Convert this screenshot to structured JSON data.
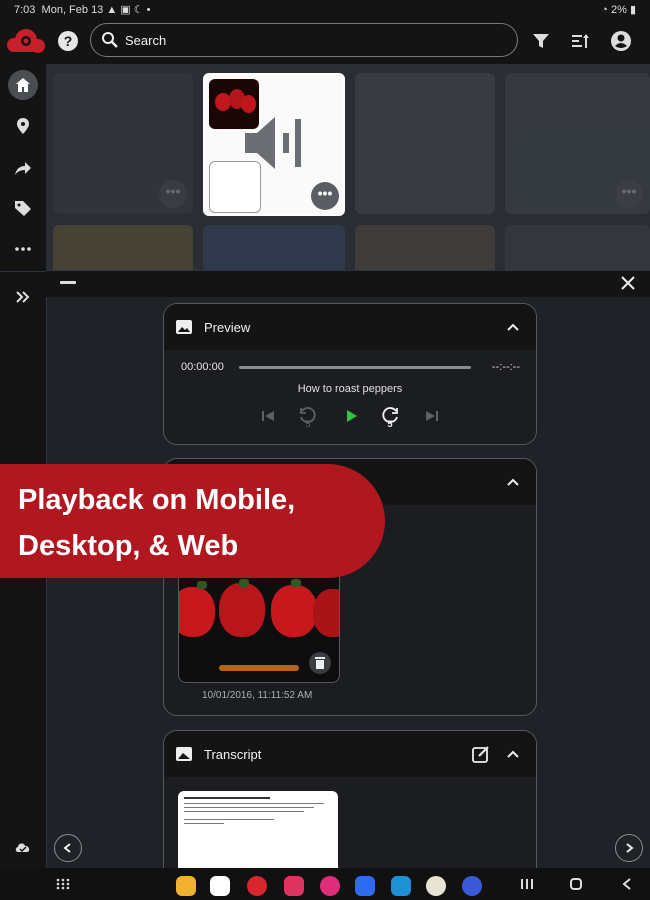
{
  "status": {
    "time": "7:03",
    "date": "Mon, Feb 13",
    "battery": "2%"
  },
  "header": {
    "search_placeholder": "Search",
    "help_glyph": "?"
  },
  "icons": {
    "logo": "cloud-logo-icon",
    "help": "help-icon",
    "search": "search-icon",
    "filter": "filter-icon",
    "sort": "sort-icon",
    "account": "account-icon",
    "sidebar": [
      "home-icon",
      "location-icon",
      "share-icon",
      "tag-icon",
      "more-icon",
      "expand-icon",
      "cloud-sync-icon"
    ]
  },
  "tile_more_glyph": "•••",
  "preview": {
    "title": "Preview",
    "elapsed": "00:00:00",
    "duration": "--:--:--",
    "track_title": "How to roast peppers",
    "skip_seconds": "5",
    "progress_fraction": 0
  },
  "banner": {
    "line1": "Playback on Mobile,",
    "line2": "Desktop, & Web"
  },
  "photo_card": {
    "timestamp": "10/01/2016, 11:11:52 AM"
  },
  "transcript": {
    "title": "Transcript"
  },
  "colors": {
    "accent_red": "#b0171f",
    "play_green": "#35c24a",
    "background": "#1f2227"
  }
}
